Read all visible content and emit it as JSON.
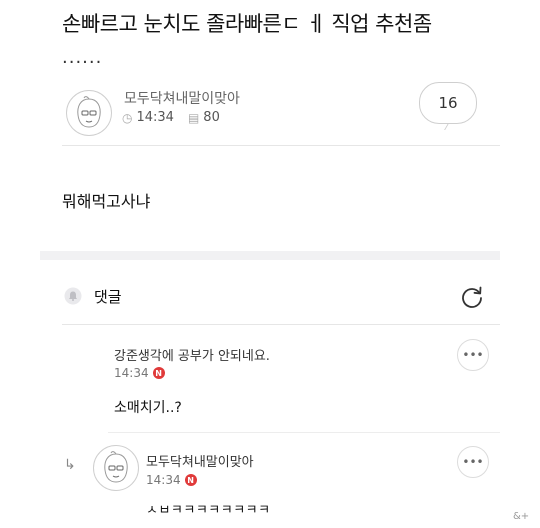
{
  "post": {
    "title": "손빠르고 눈치도 졸라빠른ㄷ ㅔ 직업 추천좀",
    "ellipsis": "......",
    "author": "모두닥쳐내말이맞아",
    "time": "14:34",
    "views": "80",
    "comment_count": "16",
    "body": "뭐해먹고사냐"
  },
  "comments_section": {
    "label": "댓글",
    "comments": [
      {
        "author": "강준생각에 공부가 안되네요.",
        "time": "14:34",
        "badge": "N",
        "text": "소매치기..?"
      },
      {
        "author": "모두닥쳐내말이맞아",
        "time": "14:34",
        "badge": "N",
        "text": "ㅅㅂㅋㅋㅋㅋㅋㅋㅋㅋ",
        "is_reply": true
      }
    ]
  },
  "watermark": "&+",
  "icons": {
    "time": "clock-icon",
    "views": "document-icon",
    "comments": "bell-icon",
    "refresh": "refresh-icon",
    "more": "more-dots-icon",
    "reply": "reply-arrow-icon"
  },
  "colors": {
    "badge": "#e03a3a",
    "divider": "#e6e6e6",
    "section_band": "#f1f1f3"
  }
}
